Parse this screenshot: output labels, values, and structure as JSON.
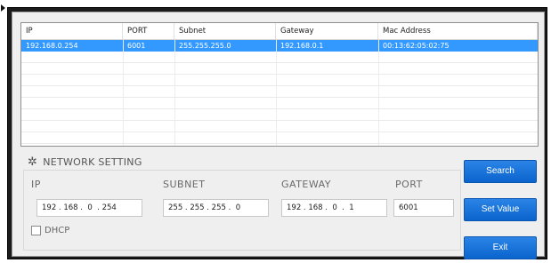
{
  "list": {
    "columns": [
      "IP",
      "PORT",
      "Subnet",
      "Gateway",
      "Mac Address"
    ],
    "rows": [
      {
        "ip": "192.168.0.254",
        "port": "6001",
        "subnet": "255.255.255.0",
        "gateway": "192.168.0.1",
        "mac": "00:13:62:05:02:75",
        "selected": true
      }
    ]
  },
  "network_setting": {
    "title": "NETWORK SETTING",
    "labels": {
      "ip": "IP",
      "subnet": "SUBNET",
      "gateway": "GATEWAY",
      "port": "PORT"
    },
    "values": {
      "ip": "192 . 168 .  0  . 254",
      "subnet": "255 . 255 . 255 .  0",
      "gateway": "192 . 168 .  0  .  1",
      "port": "6001"
    },
    "dhcp_label": "DHCP",
    "dhcp_checked": false
  },
  "buttons": {
    "search": "Search",
    "set_value": "Set Value",
    "exit": "Exit"
  },
  "colors": {
    "accent": "#1877dc",
    "selection": "#3399ff"
  },
  "icons": {
    "section": "gear-icon"
  }
}
